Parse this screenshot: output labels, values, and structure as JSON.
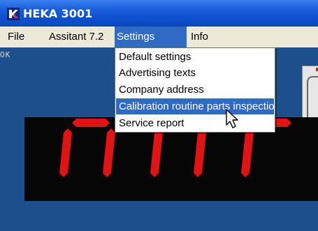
{
  "window": {
    "title": "HEKA 3001",
    "logo_icon": "heka-k-logo-icon"
  },
  "menubar": {
    "items": [
      {
        "label": "File"
      },
      {
        "label": "Assitant 7.2"
      },
      {
        "label": "Settings",
        "state": "open"
      },
      {
        "label": "Info"
      }
    ]
  },
  "settings_menu": {
    "items": [
      {
        "label": "Default settings"
      },
      {
        "label": "Advertising texts"
      },
      {
        "label": "Company address"
      },
      {
        "label": "Calibration routine parts inspection",
        "highlighted": true
      },
      {
        "label": "Service report"
      }
    ]
  },
  "app": {
    "status_text": "OK",
    "display_digits": "000"
  },
  "colors": {
    "title_bar": "#0d4fcc",
    "menu_highlight": "#316ac5",
    "app_background": "#1c4f8c",
    "display_background": "#060606",
    "segment_red": "#e01414"
  }
}
